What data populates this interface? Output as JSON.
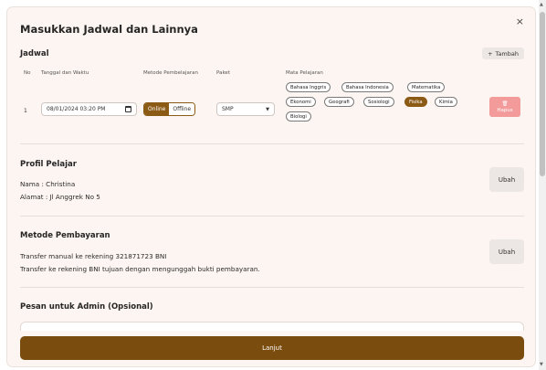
{
  "modal": {
    "title": "Masukkan Jadwal dan Lainnya",
    "close_icon": "×"
  },
  "jadwal": {
    "title": "Jadwal",
    "add_button": "Tambah",
    "columns": {
      "no": "No",
      "datetime": "Tanggal dan Waktu",
      "method": "Metode Pembelajaran",
      "package": "Paket",
      "subjects": "Mata Pelajaran"
    },
    "row": {
      "number": "1",
      "datetime": "08/01/2024 03:20 PM",
      "method_online": "Online",
      "method_offline": "Offline",
      "package": "SMP",
      "subjects": [
        {
          "label": "Bahasa Inggris",
          "selected": false
        },
        {
          "label": "Bahasa Indonesia",
          "selected": false
        },
        {
          "label": "Matematika",
          "selected": false
        },
        {
          "label": "Ekonomi",
          "selected": false
        },
        {
          "label": "Geografi",
          "selected": false
        },
        {
          "label": "Sosiologi",
          "selected": false
        },
        {
          "label": "Fisika",
          "selected": true
        },
        {
          "label": "Kimia",
          "selected": false
        },
        {
          "label": "Biologi",
          "selected": false
        }
      ],
      "delete_button": "Hapus"
    }
  },
  "profil": {
    "title": "Profil Pelajar",
    "name_line": "Nama   : Christina",
    "address_line": "Alamat : Jl Anggrek No 5",
    "edit_button": "Ubah"
  },
  "pembayaran": {
    "title": "Metode Pembayaran",
    "line1": "Transfer manual ke rekening 321871723 BNI",
    "line2": "Transfer ke rekening BNI tujuan dengan mengunggah bukti pembayaran.",
    "edit_button": "Ubah"
  },
  "pesan": {
    "title": "Pesan untuk Admin (Opsional)"
  },
  "submit_button": "Lanjut",
  "colors": {
    "accent": "#7a4d0e",
    "danger": "#f39a9a",
    "modal_bg": "#fdf5f1"
  }
}
